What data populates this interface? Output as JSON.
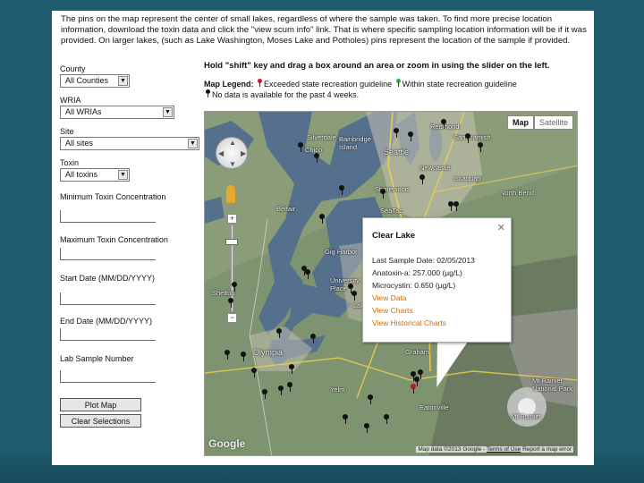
{
  "intro_text": "The pins on the map represent the center of small lakes, regardless of where the sample was taken. To find more precise location information, download the toxin data and click the \"view scum info\" link. That is where specific sampling location information will be if it was provided. On larger lakes, (such as Lake Washington, Moses Lake and Potholes) pins represent the location of the sample if provided.",
  "filters": {
    "county_label": "County",
    "county_value": "All Counties",
    "wria_label": "WRIA",
    "wria_value": "All WRIAs",
    "site_label": "Site",
    "site_value": "All sites",
    "toxin_label": "Toxin",
    "toxin_value": "All toxins",
    "min_label": "Minimum Toxin Concentration",
    "max_label": "Maximum Toxin Concentration",
    "start_label": "Start Date (MM/DD/YYYY)",
    "end_label": "End Date (MM/DD/YYYY)",
    "lab_label": "Lab Sample Number",
    "plot_button": "Plot Map",
    "clear_button": "Clear Selections"
  },
  "instructions": "Hold \"shift\" key and drag a box around an area or zoom in using the slider on the left.",
  "legend": {
    "title": "Map Legend:",
    "exceed": "Exceeded state recreation guideline",
    "within": "Within state recreation guideline",
    "nodata": "No data is available for the past 4 weeks."
  },
  "map": {
    "type_map": "Map",
    "type_satellite": "Satellite",
    "google": "Google",
    "attribution": "Map data ©2013 Google -",
    "terms": "Terms of Use",
    "report": "Report a map error",
    "places": {
      "redmond": "Redmond",
      "sammamish": "Sammamish",
      "seattle": "Seattle",
      "silverdale": "Silverdale",
      "bainbridge": "Bainbridge Island",
      "chico": "Chico",
      "newcastle": "Newcastle",
      "issaquah": "Issaquah",
      "shorewood": "Shorewood",
      "northbend": "North Bend",
      "seatac": "SeaTac",
      "belfair": "Belfair",
      "gigharbor": "Gig Harbor",
      "univplace": "University Place",
      "shelton": "Shelton",
      "olympia": "Olympia",
      "graham": "Graham",
      "yelm": "Yelm",
      "eatonville": "Eatonville",
      "mtrainier": "Mt Rainier National Park",
      "mtrainier_peak": "Mt Rainier",
      "lakewood": "Lakewood"
    },
    "popup": {
      "title": "Clear Lake",
      "last_sample": "Last Sample Date: 02/05/2013",
      "anatoxin": "Anatoxin-a: 257.000 (µg/L)",
      "microcystin": "Microcystin: 0.650 (µg/L)",
      "view_data": "View Data",
      "view_charts": "View Charts",
      "view_historical": "View Historical Charts"
    }
  }
}
